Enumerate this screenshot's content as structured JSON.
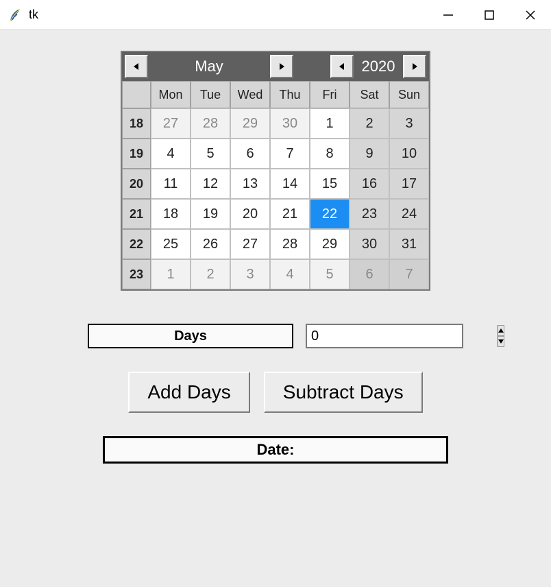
{
  "window": {
    "title": "tk",
    "controls": {
      "minimize_icon": "minimize-icon",
      "maximize_icon": "maximize-icon",
      "close_icon": "close-icon"
    }
  },
  "calendar": {
    "month_label": "May",
    "year_label": "2020",
    "nav_icons": {
      "prev_month": "triangle-left-icon",
      "next_month": "triangle-right-icon",
      "prev_year": "triangle-left-icon",
      "next_year": "triangle-right-icon"
    },
    "day_headers": [
      "Mon",
      "Tue",
      "Wed",
      "Thu",
      "Fri",
      "Sat",
      "Sun"
    ],
    "weeks": [
      {
        "num": "18",
        "days": [
          {
            "d": "27",
            "other": true
          },
          {
            "d": "28",
            "other": true
          },
          {
            "d": "29",
            "other": true
          },
          {
            "d": "30",
            "other": true
          },
          {
            "d": "1"
          },
          {
            "d": "2",
            "weekend": true
          },
          {
            "d": "3",
            "weekend": true
          }
        ]
      },
      {
        "num": "19",
        "days": [
          {
            "d": "4"
          },
          {
            "d": "5"
          },
          {
            "d": "6"
          },
          {
            "d": "7"
          },
          {
            "d": "8"
          },
          {
            "d": "9",
            "weekend": true
          },
          {
            "d": "10",
            "weekend": true
          }
        ]
      },
      {
        "num": "20",
        "days": [
          {
            "d": "11"
          },
          {
            "d": "12"
          },
          {
            "d": "13"
          },
          {
            "d": "14"
          },
          {
            "d": "15"
          },
          {
            "d": "16",
            "weekend": true
          },
          {
            "d": "17",
            "weekend": true
          }
        ]
      },
      {
        "num": "21",
        "days": [
          {
            "d": "18"
          },
          {
            "d": "19"
          },
          {
            "d": "20"
          },
          {
            "d": "21"
          },
          {
            "d": "22",
            "selected": true
          },
          {
            "d": "23",
            "weekend": true
          },
          {
            "d": "24",
            "weekend": true
          }
        ]
      },
      {
        "num": "22",
        "days": [
          {
            "d": "25"
          },
          {
            "d": "26"
          },
          {
            "d": "27"
          },
          {
            "d": "28"
          },
          {
            "d": "29"
          },
          {
            "d": "30",
            "weekend": true
          },
          {
            "d": "31",
            "weekend": true
          }
        ]
      },
      {
        "num": "23",
        "days": [
          {
            "d": "1",
            "other": true
          },
          {
            "d": "2",
            "other": true
          },
          {
            "d": "3",
            "other": true
          },
          {
            "d": "4",
            "other": true
          },
          {
            "d": "5",
            "other": true
          },
          {
            "d": "6",
            "weekend": true,
            "other": true
          },
          {
            "d": "7",
            "weekend": true,
            "other": true
          }
        ]
      }
    ]
  },
  "controls": {
    "days_label": "Days",
    "spinbox_value": "0",
    "add_button": "Add Days",
    "subtract_button": "Subtract Days",
    "date_output": "Date:"
  }
}
